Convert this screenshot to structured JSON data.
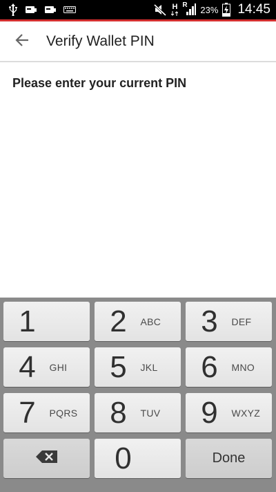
{
  "status_bar": {
    "battery_percent": "23%",
    "time": "14:45",
    "network_label": "H",
    "roaming_label": "R"
  },
  "app_bar": {
    "title": "Verify Wallet PIN"
  },
  "content": {
    "prompt": "Please enter your current PIN"
  },
  "keypad": {
    "keys": [
      {
        "digit": "1",
        "letters": ""
      },
      {
        "digit": "2",
        "letters": "ABC"
      },
      {
        "digit": "3",
        "letters": "DEF"
      },
      {
        "digit": "4",
        "letters": "GHI"
      },
      {
        "digit": "5",
        "letters": "JKL"
      },
      {
        "digit": "6",
        "letters": "MNO"
      },
      {
        "digit": "7",
        "letters": "PQRS"
      },
      {
        "digit": "8",
        "letters": "TUV"
      },
      {
        "digit": "9",
        "letters": "WXYZ"
      },
      {
        "digit": "0",
        "letters": ""
      }
    ],
    "done_label": "Done"
  },
  "colors": {
    "accent_line": "#d32f2f",
    "keypad_background": "#8a8a8a",
    "key_background": "#eaeaea"
  }
}
